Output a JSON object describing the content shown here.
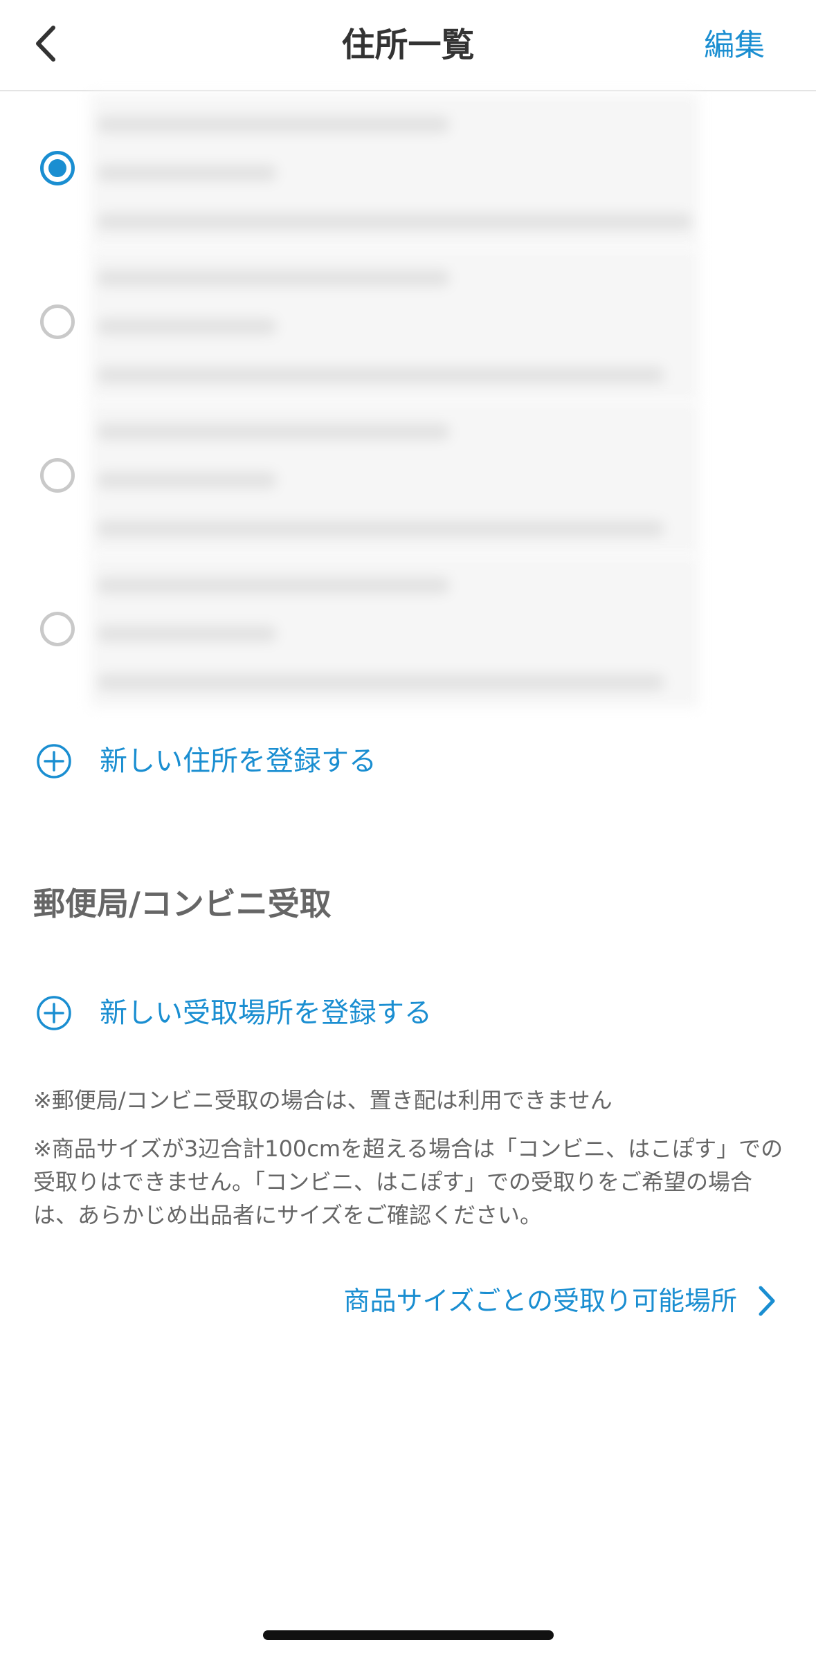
{
  "header": {
    "title": "住所一覧",
    "edit_label": "編集",
    "back_icon": "chevron-left-icon"
  },
  "addresses": [
    {
      "selected": true
    },
    {
      "selected": false
    },
    {
      "selected": false
    },
    {
      "selected": false
    }
  ],
  "add_address_label": "新しい住所を登録する",
  "pickup": {
    "section_title": "郵便局/コンビニ受取",
    "add_pickup_label": "新しい受取場所を登録する",
    "notice_1": "※郵便局/コンビニ受取の場合は、置き配は利用できません",
    "notice_2": "※商品サイズが3辺合計100cmを超える場合は「コンビニ、はこぽす」での受取りはできません。「コンビニ、はこぽす」での受取りをご希望の場合は、あらかじめ出品者にサイズをご確認ください。",
    "size_link_label": "商品サイズごとの受取り可能場所"
  },
  "colors": {
    "accent": "#1a8ed1",
    "radio_unselected": "#c9c9c9",
    "text_secondary": "#666666"
  }
}
